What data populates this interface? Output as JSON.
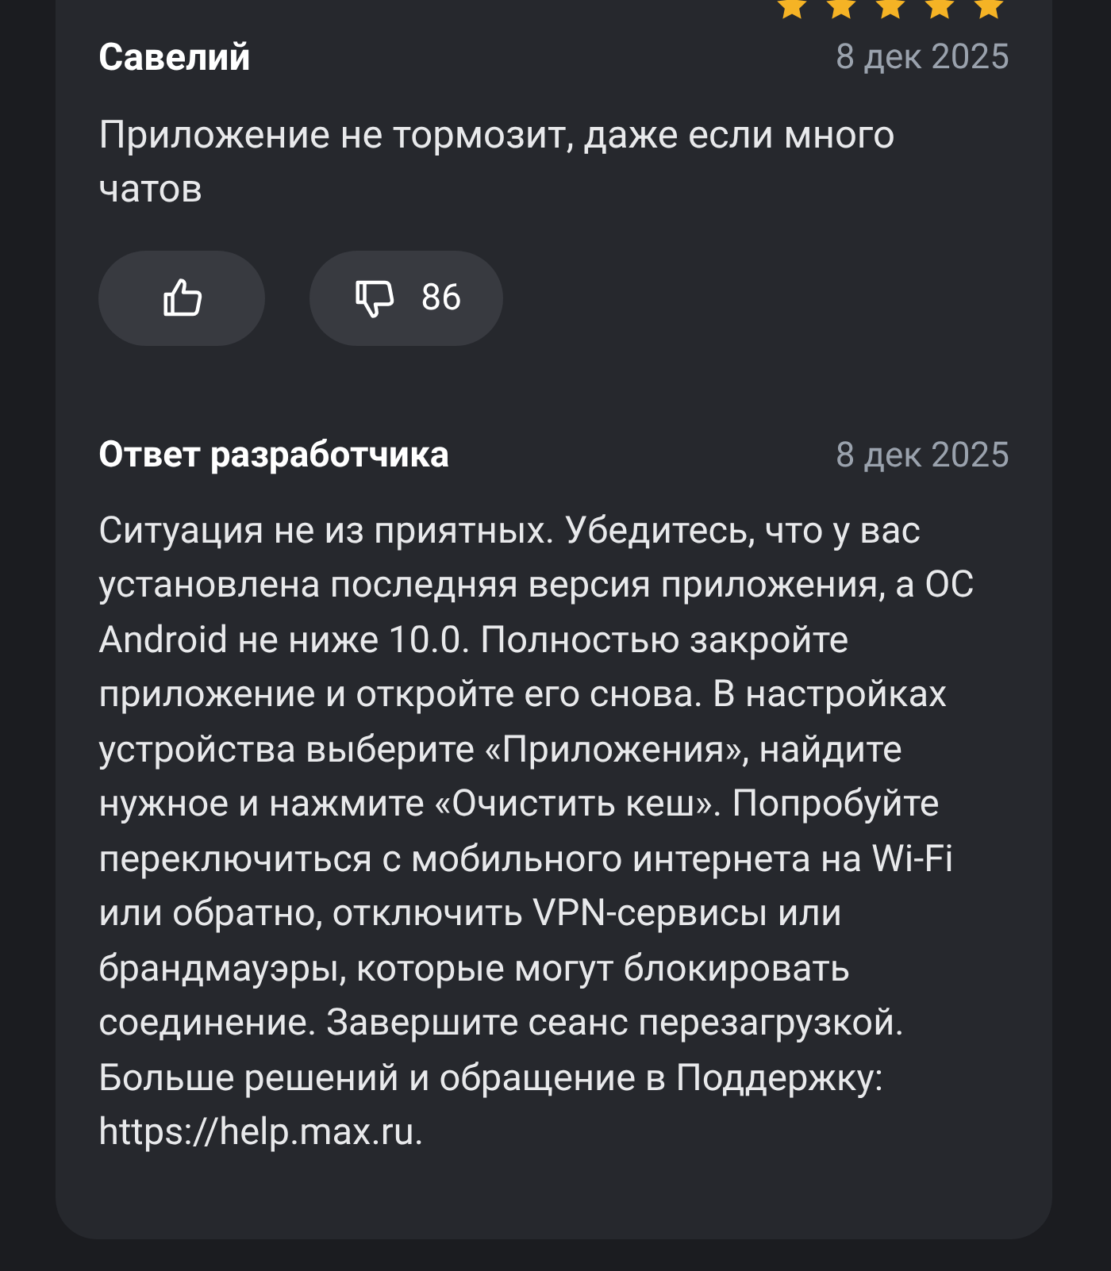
{
  "review": {
    "stars": 5,
    "author": "Савелий",
    "date": "8 дек 2025",
    "text": "Приложение не тормозит, даже если много чатов",
    "dislikes": {
      "count": "86"
    }
  },
  "developer_reply": {
    "title": "Ответ разработчика",
    "date": "8 дек 2025",
    "text": "Ситуация не из приятных. Убедитесь, что у вас установлена последняя версия приложения, а ОС Android не ниже 10.0. Полностью закройте приложение и откройте его снова. В настройках устройства выберите «Приложения», найдите нужное и нажмите «Очистить кеш». Попробуйте переключиться с мобильного интернета на Wi-Fi или обратно, отключить VPN-сервисы или брандмауэры, которые могут блокировать соединение. Завершите сеанс перезагрузкой. Больше решений и обращение в Поддержку: https://help.max.ru."
  }
}
